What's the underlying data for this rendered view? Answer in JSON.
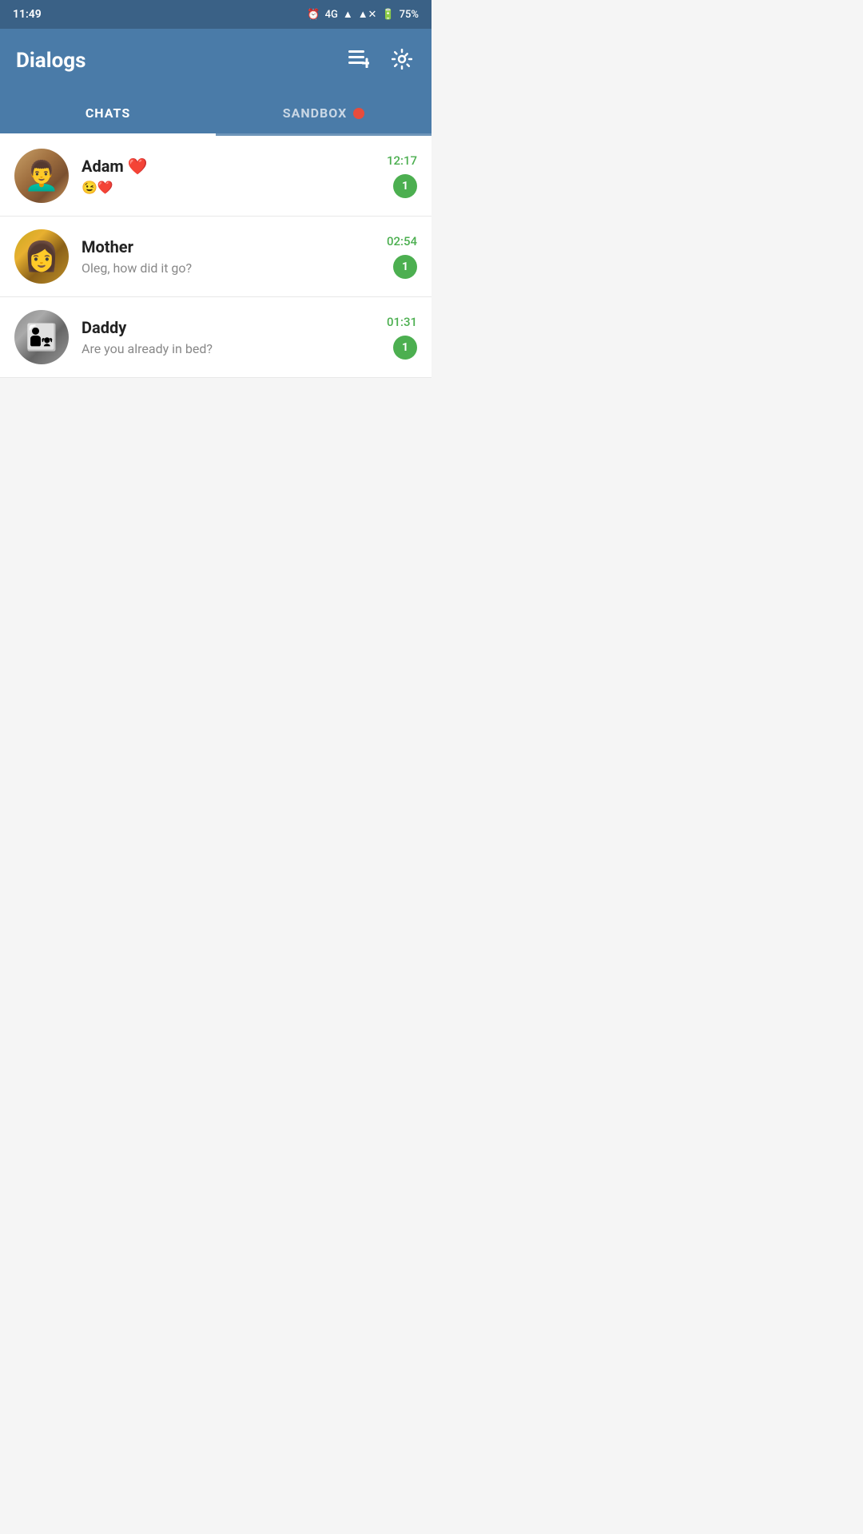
{
  "statusBar": {
    "time": "11:49",
    "network": "4G",
    "battery": "75%"
  },
  "header": {
    "title": "Dialogs",
    "addIcon": "≡+",
    "settingsIcon": "⚙"
  },
  "tabs": [
    {
      "id": "chats",
      "label": "CHATS",
      "active": true
    },
    {
      "id": "sandbox",
      "label": "SANDBOX",
      "active": false,
      "hasDot": true
    }
  ],
  "chats": [
    {
      "id": "adam",
      "name": "Adam ❤️",
      "preview": "😉❤️",
      "time": "12:17",
      "unread": "1",
      "avatarClass": "avatar-adam"
    },
    {
      "id": "mother",
      "name": "Mother",
      "preview": "Oleg, how did it go?",
      "time": "02:54",
      "unread": "1",
      "avatarClass": "avatar-mother"
    },
    {
      "id": "daddy",
      "name": "Daddy",
      "preview": "Are you already in bed?",
      "time": "01:31",
      "unread": "1",
      "avatarClass": "avatar-daddy"
    }
  ]
}
